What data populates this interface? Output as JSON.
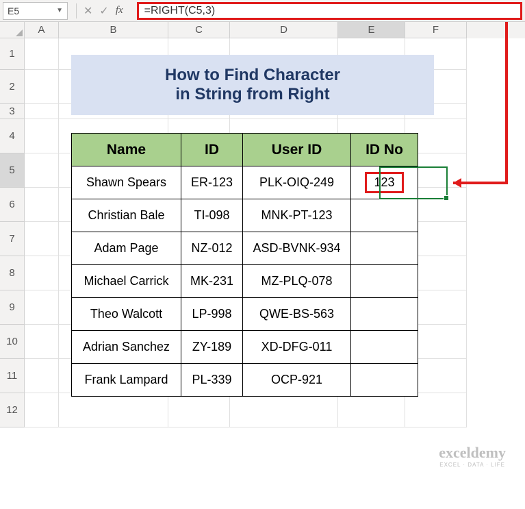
{
  "name_box": "E5",
  "formula": "=RIGHT(C5,3)",
  "columns": [
    "A",
    "B",
    "C",
    "D",
    "E",
    "F"
  ],
  "rows": [
    "1",
    "2",
    "3",
    "4",
    "5",
    "6",
    "7",
    "8",
    "9",
    "10",
    "11",
    "12"
  ],
  "title": {
    "line1": "How to Find Character",
    "line2": "in String from Right"
  },
  "headers": {
    "name": "Name",
    "id": "ID",
    "userid": "User ID",
    "idno": "ID No"
  },
  "data": [
    {
      "name": "Shawn Spears",
      "id": "ER-123",
      "userid": "PLK-OIQ-249",
      "idno": "123"
    },
    {
      "name": "Christian Bale",
      "id": "TI-098",
      "userid": "MNK-PT-123",
      "idno": ""
    },
    {
      "name": "Adam Page",
      "id": "NZ-012",
      "userid": "ASD-BVNK-934",
      "idno": ""
    },
    {
      "name": "Michael Carrick",
      "id": "MK-231",
      "userid": "MZ-PLQ-078",
      "idno": ""
    },
    {
      "name": "Theo Walcott",
      "id": "LP-998",
      "userid": "QWE-BS-563",
      "idno": ""
    },
    {
      "name": "Adrian Sanchez",
      "id": "ZY-189",
      "userid": "XD-DFG-011",
      "idno": ""
    },
    {
      "name": "Frank Lampard",
      "id": "PL-339",
      "userid": "OCP-921",
      "idno": ""
    }
  ],
  "watermark": {
    "brand": "exceldemy",
    "sub": "EXCEL · DATA · LIFE"
  }
}
